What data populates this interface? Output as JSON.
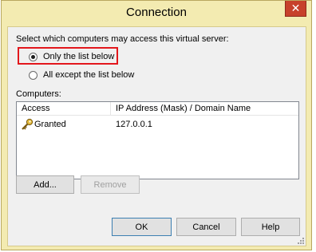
{
  "window": {
    "title": "Connection",
    "close_glyph": "✕"
  },
  "dialog": {
    "prompt": "Select which computers may access this virtual server:",
    "options": [
      {
        "label": "Only the list below",
        "selected": true
      },
      {
        "label": "All except the list below",
        "selected": false
      }
    ],
    "highlight_color": "#e3171c"
  },
  "computers": {
    "label": "Computers:",
    "columns": [
      "Access",
      "IP Address (Mask) / Domain Name"
    ],
    "rows": [
      {
        "icon": "key-icon",
        "access": "Granted",
        "address": "127.0.0.1"
      }
    ]
  },
  "buttons": {
    "add": "Add...",
    "remove": "Remove",
    "ok": "OK",
    "cancel": "Cancel",
    "help": "Help"
  }
}
